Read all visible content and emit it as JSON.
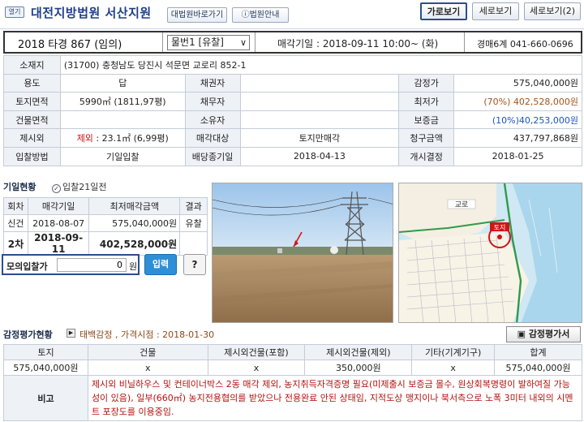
{
  "header": {
    "print_label": "열기",
    "court": "대전지방법원 서산지원",
    "court_link_label": "대법원바로가기",
    "court_info_label": "법원안내",
    "view_buttons": [
      "가로보기",
      "세로보기",
      "세로보기(2)"
    ]
  },
  "case": {
    "number": "2018 타경 867 (임의)",
    "item_select": "물번1 [유찰]",
    "sale_date": "매각기일 : 2018-09-11 10:00~ (화)",
    "department": "경매6계 041-660-0696"
  },
  "info": {
    "address_label": "소재지",
    "address": "(31700) 충청남도 당진시 석문면 교로리 852-1",
    "rows": [
      {
        "l1": "용도",
        "v1": "답",
        "l2": "채권자",
        "v2": "",
        "l3": "감정가",
        "v3": "575,040,000원"
      },
      {
        "l1": "토지면적",
        "v1": "5990㎡ (1811,97평)",
        "l2": "채무자",
        "v2": "",
        "l3": "최저가",
        "v3a": "(70%)",
        "v3b": " 402,528,000원"
      },
      {
        "l1": "건물면적",
        "v1": "",
        "l2": "소유자",
        "v2": "",
        "l3": "보증금",
        "v3": "(10%)40,253,000원"
      },
      {
        "l1": "제시외",
        "v1a": "제외",
        "v1b": " : 23.1㎡ (6,99평)",
        "l2": "매각대상",
        "v2": "토지만매각",
        "l3": "청구금액",
        "v3": "437,797,868원"
      },
      {
        "l1": "입찰방법",
        "v1": "기일입찰",
        "l2": "배당종기일",
        "v2": "2018-04-13",
        "l3": "개시결정",
        "v3": "2018-01-25"
      }
    ]
  },
  "history": {
    "title": "기일현황",
    "check_label": "입찰21일전",
    "headers": [
      "회차",
      "매각기일",
      "최저매각금액",
      "결과"
    ],
    "rows": [
      {
        "round": "신건",
        "date": "2018-08-07",
        "price": "575,040,000원",
        "result": "유찰"
      },
      {
        "round": "2차",
        "date": "2018-09-11",
        "price": "402,528,000원",
        "result": ""
      }
    ]
  },
  "mock_bid": {
    "label": "모의입찰가",
    "value": "0",
    "unit": "원",
    "submit_label": "입력",
    "help_label": "?"
  },
  "map": {
    "region_label": "교로",
    "marker_label": "토지"
  },
  "appraisal": {
    "title": "감정평가현황",
    "subtitle": "태백감정 , 가격시점 : 2018-01-30",
    "button_label": "감정평가서",
    "headers": [
      "토지",
      "건물",
      "제시외건물(포함)",
      "제시외건물(제외)",
      "기타(기계기구)",
      "합계"
    ],
    "values": [
      "575,040,000원",
      "x",
      "x",
      "350,000원",
      "x",
      "575,040,000원"
    ],
    "note_label": "비고",
    "note": "제시외 비닐하우스 및 컨테이너박스 2동 매각 제외, 농지취득자격증명 필요(미제출시 보증금 몰수, 원상회복명령이 발하여질 가능성이 있음), 일부(660㎡) 농지전용협의를 받았으나 전용완료 안된 상태임, 지적도상 맹지이나 북서측으로 노폭 3미터 내외의 시멘트 포장도를 이용중임."
  },
  "colors": {
    "accent": "#1f3f87",
    "label_bg": "#eef1f6",
    "note_red": "#b3120f",
    "input_button": "#2f8fd6"
  }
}
